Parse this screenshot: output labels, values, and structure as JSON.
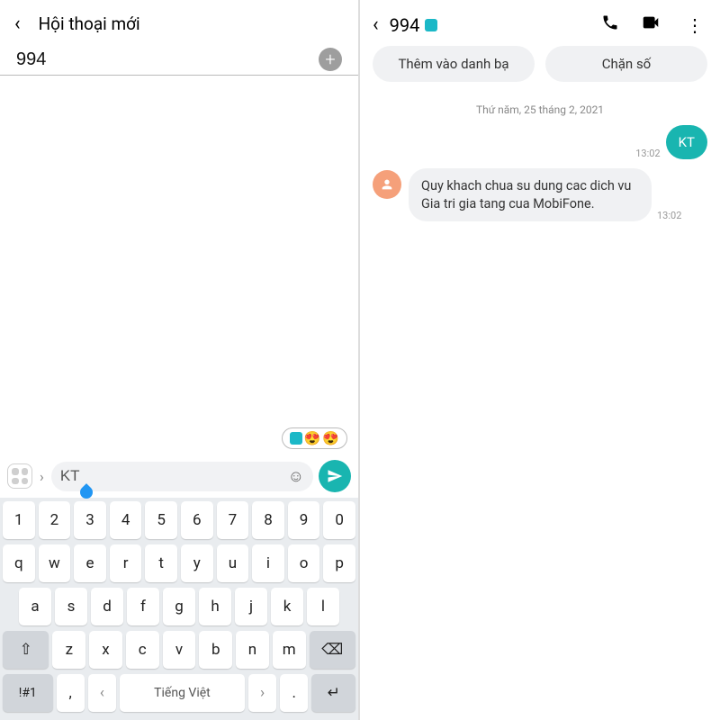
{
  "left": {
    "header_title": "Hội thoại mới",
    "recipient": "994",
    "compose_value": "KT",
    "emoji_pill": {
      "e1": "😍",
      "e2": "😍"
    },
    "keyboard": {
      "row1": [
        "1",
        "2",
        "3",
        "4",
        "5",
        "6",
        "7",
        "8",
        "9",
        "0"
      ],
      "row2": [
        "q",
        "w",
        "e",
        "r",
        "t",
        "y",
        "u",
        "i",
        "o",
        "p"
      ],
      "row3": [
        "a",
        "s",
        "d",
        "f",
        "g",
        "h",
        "j",
        "k",
        "l"
      ],
      "row4_letters": [
        "z",
        "x",
        "c",
        "v",
        "b",
        "n",
        "m"
      ],
      "shift": "⇧",
      "backspace": "⌫",
      "sym": "!#1",
      "comma": ",",
      "left_arrow": "‹",
      "space": "Tiếng Việt",
      "right_arrow": "›",
      "dot": ".",
      "enter": "↵"
    }
  },
  "right": {
    "title": "994",
    "add_contact": "Thêm vào danh bạ",
    "block": "Chặn số",
    "date": "Thứ năm, 25 tháng 2, 2021",
    "out": {
      "text": "KT",
      "time": "13:02"
    },
    "in": {
      "text": "Quy khach chua su dung cac dich vu Gia tri gia tang cua MobiFone.",
      "time": "13:02"
    }
  }
}
